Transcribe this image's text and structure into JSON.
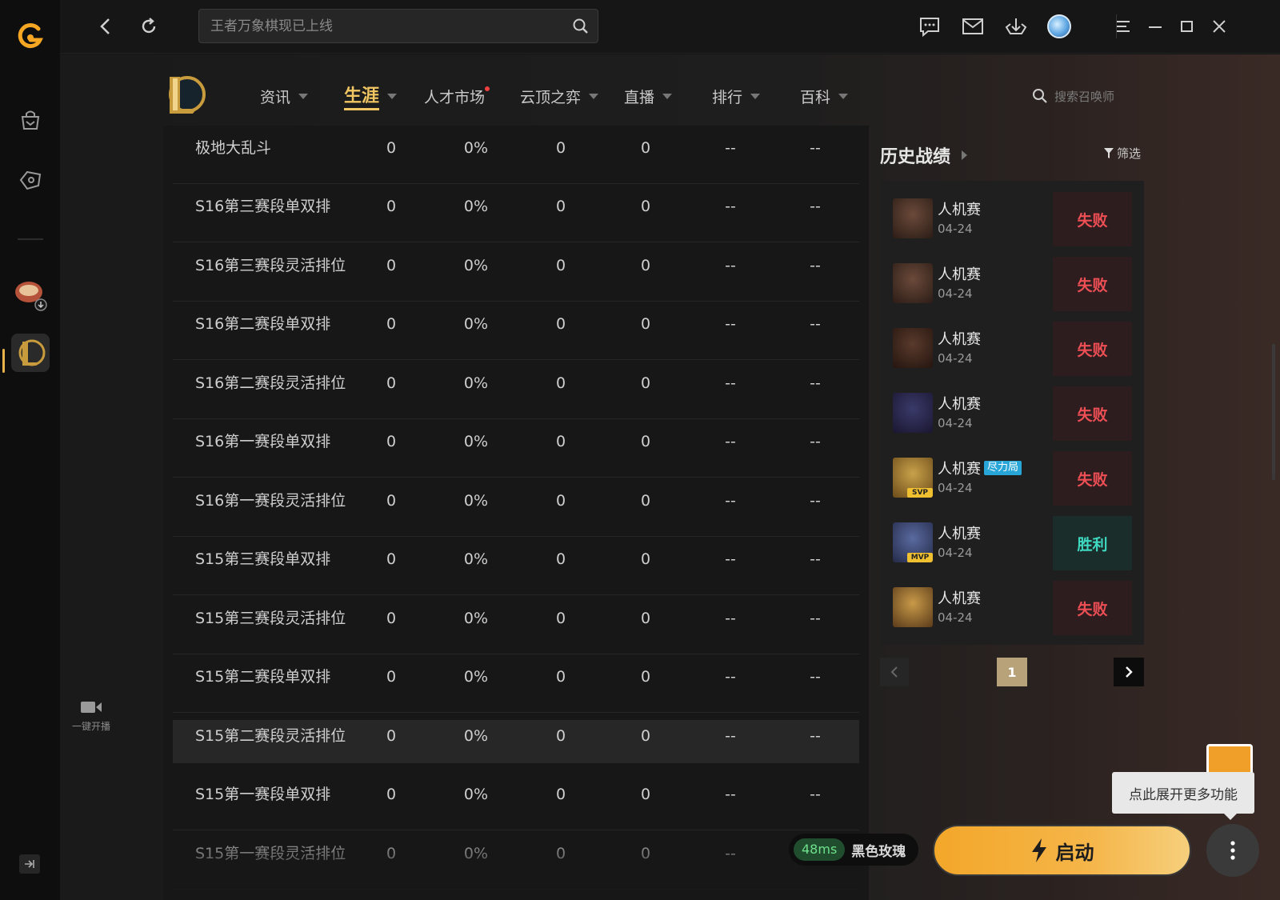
{
  "topbar": {
    "search_placeholder": "王者万象棋现已上线"
  },
  "nav": {
    "tabs": [
      {
        "label": "资讯"
      },
      {
        "label": "生涯"
      },
      {
        "label": "人才市场"
      },
      {
        "label": "云顶之弈"
      },
      {
        "label": "直播"
      },
      {
        "label": "排行"
      },
      {
        "label": "百科"
      }
    ],
    "active_tab": "生涯",
    "summoner_search_placeholder": "搜索召唤师"
  },
  "stats_table": {
    "rows": [
      [
        "极地大乱斗",
        "0",
        "0%",
        "0",
        "0",
        "--",
        "--"
      ],
      [
        "S16第三赛段单双排",
        "0",
        "0%",
        "0",
        "0",
        "--",
        "--"
      ],
      [
        "S16第三赛段灵活排位",
        "0",
        "0%",
        "0",
        "0",
        "--",
        "--"
      ],
      [
        "S16第二赛段单双排",
        "0",
        "0%",
        "0",
        "0",
        "--",
        "--"
      ],
      [
        "S16第二赛段灵活排位",
        "0",
        "0%",
        "0",
        "0",
        "--",
        "--"
      ],
      [
        "S16第一赛段单双排",
        "0",
        "0%",
        "0",
        "0",
        "--",
        "--"
      ],
      [
        "S16第一赛段灵活排位",
        "0",
        "0%",
        "0",
        "0",
        "--",
        "--"
      ],
      [
        "S15第三赛段单双排",
        "0",
        "0%",
        "0",
        "0",
        "--",
        "--"
      ],
      [
        "S15第三赛段灵活排位",
        "0",
        "0%",
        "0",
        "0",
        "--",
        "--"
      ],
      [
        "S15第二赛段单双排",
        "0",
        "0%",
        "0",
        "0",
        "--",
        "--"
      ],
      [
        "S15第二赛段灵活排位",
        "0",
        "0%",
        "0",
        "0",
        "--",
        "--"
      ],
      [
        "S15第一赛段单双排",
        "0",
        "0%",
        "0",
        "0",
        "--",
        "--"
      ],
      [
        "S15第一赛段灵活排位",
        "0",
        "0%",
        "0",
        "0",
        "--",
        "--"
      ]
    ],
    "highlighted_row": 10
  },
  "history": {
    "title": "历史战绩",
    "filter_label": "筛选",
    "matches": [
      {
        "mode": "人机赛",
        "date": "04-24",
        "result": "失败",
        "outcome": "lose",
        "tag": "",
        "badge": ""
      },
      {
        "mode": "人机赛",
        "date": "04-24",
        "result": "失败",
        "outcome": "lose",
        "tag": "",
        "badge": ""
      },
      {
        "mode": "人机赛",
        "date": "04-24",
        "result": "失败",
        "outcome": "lose",
        "tag": "",
        "badge": ""
      },
      {
        "mode": "人机赛",
        "date": "04-24",
        "result": "失败",
        "outcome": "lose",
        "tag": "",
        "badge": ""
      },
      {
        "mode": "人机赛",
        "date": "04-24",
        "result": "失败",
        "outcome": "lose",
        "tag": "尽力局",
        "badge": "SVP"
      },
      {
        "mode": "人机赛",
        "date": "04-24",
        "result": "胜利",
        "outcome": "win",
        "tag": "",
        "badge": "MVP"
      },
      {
        "mode": "人机赛",
        "date": "04-24",
        "result": "失败",
        "outcome": "lose",
        "tag": "",
        "badge": ""
      }
    ],
    "current_page": "1"
  },
  "sidebar": {
    "live_label": "一键开播"
  },
  "footer": {
    "ping": "48ms",
    "server": "黑色玫瑰",
    "launch_label": "启动",
    "tooltip": "点此展开更多功能"
  },
  "colors": {
    "accent": "#f2c662",
    "lose": "#ee4f55",
    "win": "#3fd8c0",
    "launch": "#f3a72a"
  }
}
